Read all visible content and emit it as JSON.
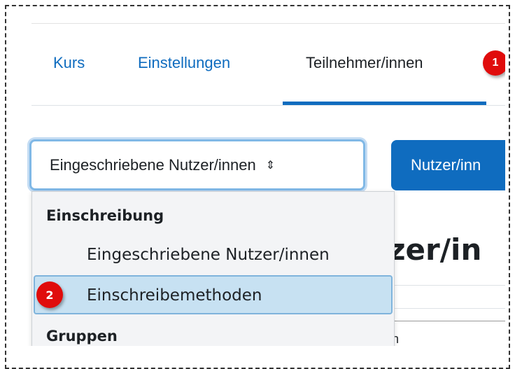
{
  "tabs": [
    {
      "label": "Kurs"
    },
    {
      "label": "Einstellungen"
    },
    {
      "label": "Teilnehmer/innen"
    }
  ],
  "badges": {
    "first": "1",
    "second": "2"
  },
  "select": {
    "value": "Eingeschriebene Nutzer/innen",
    "arrows": "⇕"
  },
  "primary_button": {
    "label": "Nutzer/inn"
  },
  "heading": {
    "text": "tzer/in"
  },
  "background_text": "n",
  "dropdown": {
    "groups": [
      {
        "label": "Einschreibung",
        "options": [
          "Eingeschriebene Nutzer/innen",
          "Einschreibemethoden"
        ]
      },
      {
        "label": "Gruppen"
      }
    ],
    "selected": "Einschreibemethoden"
  },
  "colors": {
    "accent": "#0f6cbf",
    "badge": "#e00c0c",
    "selected_bg": "#c7e1f2"
  }
}
